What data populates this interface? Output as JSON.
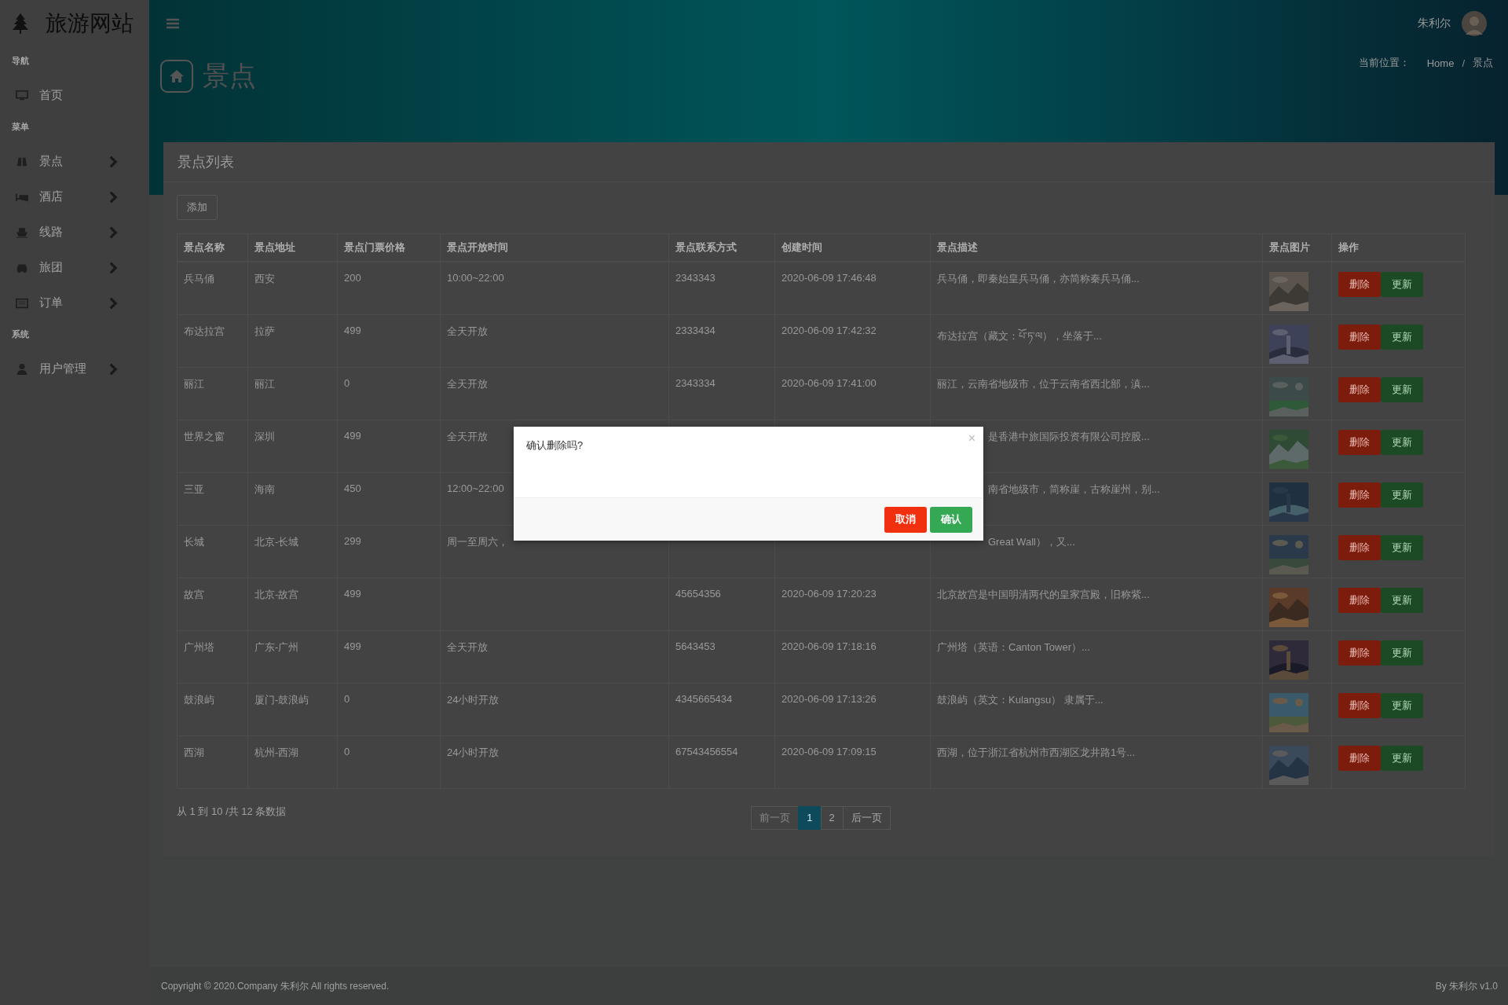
{
  "sidebar": {
    "brand": "旅游网站",
    "sections": [
      {
        "heading": "导航",
        "items": [
          {
            "label": "首页",
            "has_submenu": false
          }
        ]
      },
      {
        "heading": "菜单",
        "items": [
          {
            "label": "景点",
            "has_submenu": true
          },
          {
            "label": "酒店",
            "has_submenu": true
          },
          {
            "label": "线路",
            "has_submenu": true
          },
          {
            "label": "旅团",
            "has_submenu": true
          },
          {
            "label": "订单",
            "has_submenu": true
          }
        ]
      },
      {
        "heading": "系统",
        "items": [
          {
            "label": "用户管理",
            "has_submenu": true
          }
        ]
      }
    ]
  },
  "header": {
    "user": "朱利尔",
    "page_title": "景点",
    "breadcrumb": {
      "label": "当前位置：",
      "separator": "/",
      "items": [
        "Home",
        "景点"
      ]
    }
  },
  "panel": {
    "title": "景点列表",
    "add_button": "添加",
    "table": {
      "columns": [
        "景点名称",
        "景点地址",
        "景点门票价格",
        "景点开放时间",
        "景点联系方式",
        "创建时间",
        "景点描述",
        "景点图片",
        "操作"
      ],
      "rows": [
        {
          "cells": [
            "兵马俑",
            "西安",
            "200",
            "10:00~22:00",
            "2343343",
            "2020-06-09 17:46:48",
            "兵马俑，即秦始皇兵马俑，亦简称秦兵马俑..."
          ],
          "image": {
            "kind": "picture"
          },
          "actions": [
            "删除",
            "更新"
          ]
        },
        {
          "cells": [
            "布达拉宫",
            "拉萨",
            "499",
            "全天开放",
            "2333434",
            "2020-06-09 17:42:32",
            "布达拉宫（藏文：པོ་ཏ་ལ），坐落于..."
          ],
          "image": {
            "kind": "picture"
          },
          "actions": [
            "删除",
            "更新"
          ]
        },
        {
          "cells": [
            "丽江",
            "丽江",
            "0",
            "全天开放",
            "2343334",
            "2020-06-09 17:41:00",
            "丽江，云南省地级市，位于云南省西北部，滇..."
          ],
          "image": {
            "kind": "picture"
          },
          "actions": [
            "删除",
            "更新"
          ]
        },
        {
          "cells": [
            "世界之窗",
            "深圳",
            "499",
            "全天开放",
            null,
            null,
            "是香港中旅国际投资有限公司控股..."
          ],
          "image": {
            "kind": "picture"
          },
          "actions": [
            "删除",
            "更新"
          ]
        },
        {
          "cells": [
            "三亚",
            "海南",
            "450",
            "12:00~22:00",
            null,
            null,
            "南省地级市，简称崖，古称崖州，别..."
          ],
          "image": {
            "kind": "picture"
          },
          "actions": [
            "删除",
            "更新"
          ]
        },
        {
          "cells": [
            "长城",
            "北京-长城",
            "299",
            "周一至周六，",
            null,
            null,
            "Great Wall），又..."
          ],
          "image": {
            "kind": "picture"
          },
          "actions": [
            "删除",
            "更新"
          ]
        },
        {
          "cells": [
            "故宫",
            "北京-故宫",
            "499",
            null,
            "45654356",
            "2020-06-09 17:20:23",
            "北京故宫是中国明清两代的皇家宫殿，旧称紫..."
          ],
          "image": {
            "kind": "picture"
          },
          "actions": [
            "删除",
            "更新"
          ]
        },
        {
          "cells": [
            "广州塔",
            "广东-广州",
            "499",
            "全天开放",
            "5643453",
            "2020-06-09 17:18:16",
            "广州塔（英语：Canton Tower）..."
          ],
          "image": {
            "kind": "picture"
          },
          "actions": [
            "删除",
            "更新"
          ]
        },
        {
          "cells": [
            "鼓浪屿",
            "厦门-鼓浪屿",
            "0",
            "24小时开放",
            "4345665434",
            "2020-06-09 17:13:26",
            "鼓浪屿（英文：Kulangsu） 隶属于..."
          ],
          "image": {
            "kind": "picture"
          },
          "actions": [
            "删除",
            "更新"
          ]
        },
        {
          "cells": [
            "西湖",
            "杭州-西湖",
            "0",
            "24小时开放",
            "67543456554",
            "2020-06-09 17:09:15",
            "西湖，位于浙江省杭州市西湖区龙井路1号..."
          ],
          "image": {
            "kind": "picture"
          },
          "actions": [
            "删除",
            "更新"
          ]
        }
      ]
    },
    "summary": "从 1 到 10 /共 12 条数据",
    "pagination": [
      {
        "label": "前一页",
        "selected": false,
        "disabled": true
      },
      {
        "label": "1",
        "selected": true,
        "disabled": false
      },
      {
        "label": "2",
        "selected": false,
        "disabled": false
      },
      {
        "label": "后一页",
        "selected": false,
        "disabled": false
      }
    ]
  },
  "modal": {
    "message": "确认删除吗?",
    "close": "×",
    "buttons": [
      {
        "label": "取消",
        "kind": "cancel"
      },
      {
        "label": "确认",
        "kind": "confirm"
      }
    ]
  },
  "footer": {
    "copyright": "Copyright © 2020.Company 朱利尔 All rights reserved.",
    "credit": "By 朱利尔 v1.0"
  }
}
